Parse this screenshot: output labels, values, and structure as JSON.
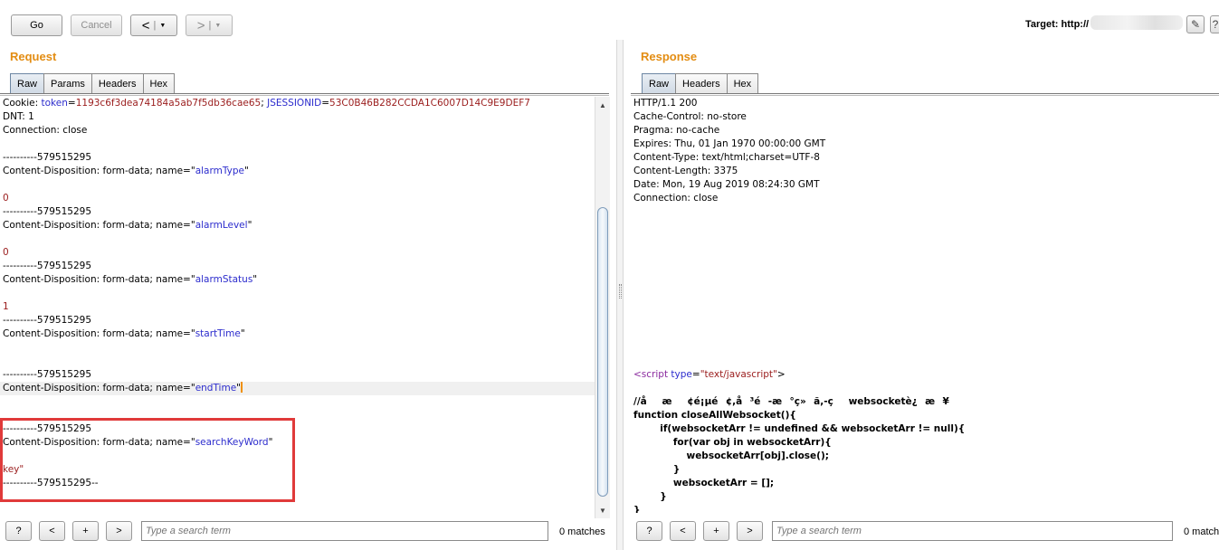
{
  "toolbar": {
    "go_label": "Go",
    "cancel_label": "Cancel",
    "back_arrow": "<",
    "forward_arrow": ">",
    "dropdown_glyph": "▼",
    "target_label": "Target: http://"
  },
  "request": {
    "title": "Request",
    "tabs": [
      "Raw",
      "Params",
      "Headers",
      "Hex"
    ],
    "active_tab": "Raw",
    "lines": [
      [
        {
          "t": "Cookie: "
        },
        {
          "t": "token",
          "c": "blue"
        },
        {
          "t": "="
        },
        {
          "t": "1193c6f3dea74184a5ab7f5db36cae65",
          "c": "red"
        },
        {
          "t": "; "
        },
        {
          "t": "JSESSIONID",
          "c": "blue"
        },
        {
          "t": "="
        },
        {
          "t": "53C0B46B282CCDA1C6007D14C9E9DEF7",
          "c": "red"
        }
      ],
      [
        {
          "t": "DNT: 1"
        }
      ],
      [
        {
          "t": "Connection: close"
        }
      ],
      [
        {
          "t": ""
        }
      ],
      [
        {
          "t": "----------579515295"
        }
      ],
      [
        {
          "t": "Content-Disposition: form-data; name=\""
        },
        {
          "t": "alarmType",
          "c": "blue"
        },
        {
          "t": "\""
        }
      ],
      [
        {
          "t": ""
        }
      ],
      [
        {
          "t": "0",
          "c": "red"
        }
      ],
      [
        {
          "t": "----------579515295"
        }
      ],
      [
        {
          "t": "Content-Disposition: form-data; name=\""
        },
        {
          "t": "alarmLevel",
          "c": "blue"
        },
        {
          "t": "\""
        }
      ],
      [
        {
          "t": ""
        }
      ],
      [
        {
          "t": "0",
          "c": "red"
        }
      ],
      [
        {
          "t": "----------579515295"
        }
      ],
      [
        {
          "t": "Content-Disposition: form-data; name=\""
        },
        {
          "t": "alarmStatus",
          "c": "blue"
        },
        {
          "t": "\""
        }
      ],
      [
        {
          "t": ""
        }
      ],
      [
        {
          "t": "1",
          "c": "red"
        }
      ],
      [
        {
          "t": "----------579515295"
        }
      ],
      [
        {
          "t": "Content-Disposition: form-data; name=\""
        },
        {
          "t": "startTime",
          "c": "blue"
        },
        {
          "t": "\""
        }
      ],
      [
        {
          "t": ""
        }
      ],
      [
        {
          "t": ""
        }
      ],
      [
        {
          "t": "----------579515295"
        }
      ],
      [
        {
          "t": "Content-Disposition: form-data; name=\""
        },
        {
          "t": "endTime",
          "c": "blue"
        },
        {
          "t": "\""
        },
        {
          "caret": true
        }
      ],
      [
        {
          "t": ""
        }
      ],
      [
        {
          "t": ""
        }
      ],
      [
        {
          "t": "----------579515295"
        }
      ],
      [
        {
          "t": "Content-Disposition: form-data; name=\""
        },
        {
          "t": "searchKeyWord",
          "c": "blue"
        },
        {
          "t": "\""
        }
      ],
      [
        {
          "t": ""
        }
      ],
      [
        {
          "t": "key\"",
          "c": "red"
        }
      ],
      [
        {
          "t": "----------579515295--"
        }
      ]
    ],
    "highlighted_line": 21
  },
  "response": {
    "title": "Response",
    "tabs": [
      "Raw",
      "Headers",
      "Hex"
    ],
    "active_tab": "Raw",
    "lines": [
      [
        {
          "t": "HTTP/1.1 200"
        }
      ],
      [
        {
          "t": "Cache-Control: no-store"
        }
      ],
      [
        {
          "t": "Pragma: no-cache"
        }
      ],
      [
        {
          "t": "Expires: Thu, 01 Jan 1970 00:00:00 GMT"
        }
      ],
      [
        {
          "t": "Content-Type: text/html;charset=UTF-8"
        }
      ],
      [
        {
          "t": "Content-Length: 3375"
        }
      ],
      [
        {
          "t": "Date: Mon, 19 Aug 2019 08:24:30 GMT"
        }
      ],
      [
        {
          "t": "Connection: close"
        }
      ],
      [
        {
          "t": ""
        }
      ],
      [
        {
          "t": ""
        }
      ],
      [
        {
          "t": ""
        }
      ],
      [
        {
          "t": ""
        }
      ],
      [
        {
          "t": ""
        }
      ],
      [
        {
          "t": ""
        }
      ],
      [
        {
          "t": ""
        }
      ],
      [
        {
          "t": ""
        }
      ],
      [
        {
          "t": ""
        }
      ],
      [
        {
          "t": ""
        }
      ],
      [
        {
          "t": ""
        }
      ],
      [
        {
          "t": ""
        }
      ],
      [
        {
          "t": "<script ",
          "c": "purple"
        },
        {
          "t": "type",
          "c": "blue"
        },
        {
          "t": "="
        },
        {
          "t": "\"text/javascript\"",
          "c": "red"
        },
        {
          "t": ">"
        }
      ],
      [
        {
          "t": ""
        }
      ],
      [
        {
          "t": "//åæ¢é¡µé¢,å³é-æ°ç»ã,-çwebsocketè¿æ¥",
          "c": "bold"
        }
      ],
      [
        {
          "t": "function closeAllWebsocket(){",
          "c": "bold"
        }
      ],
      [
        {
          "t": "        if(websocketArr != undefined && websocketArr != null){",
          "c": "bold"
        }
      ],
      [
        {
          "t": "            for(var obj in websocketArr){",
          "c": "bold"
        }
      ],
      [
        {
          "t": "                websocketArr[obj].close();",
          "c": "bold"
        }
      ],
      [
        {
          "t": "            }",
          "c": "bold"
        }
      ],
      [
        {
          "t": "            websocketArr = [];",
          "c": "bold"
        }
      ],
      [
        {
          "t": "        }",
          "c": "bold"
        }
      ],
      [
        {
          "t": "}",
          "c": "bold"
        }
      ]
    ]
  },
  "bottom": {
    "help": "?",
    "prev": "<",
    "add": "+",
    "next": ">",
    "search_placeholder": "Type a search term",
    "matches": "0 matches"
  },
  "colors": {
    "title_orange": "#e38d13",
    "highlight_red": "#e03a3a"
  }
}
